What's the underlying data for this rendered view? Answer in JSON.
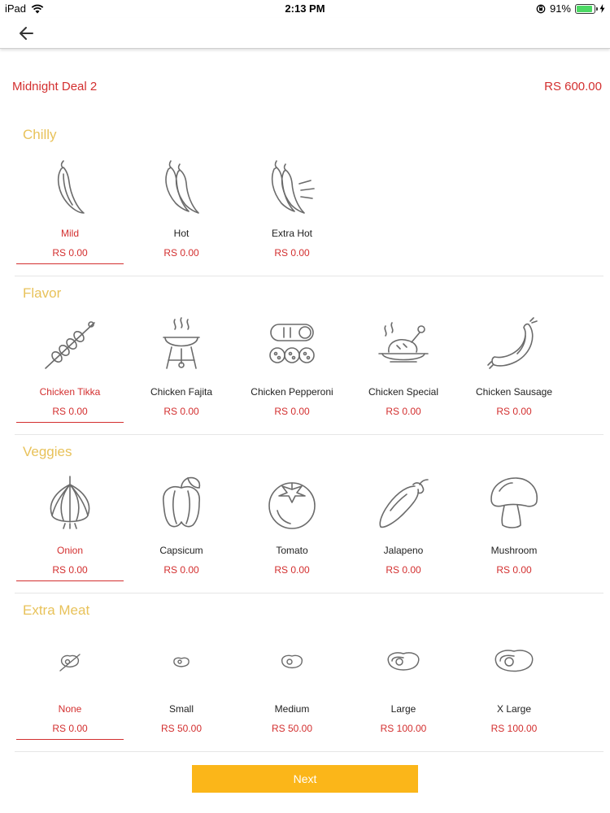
{
  "status_bar": {
    "device": "iPad",
    "time": "2:13 PM",
    "battery": "91%",
    "battery_level": 0.91
  },
  "nav": {
    "back_icon": "arrow-left-icon"
  },
  "deal": {
    "name": "Midnight Deal 2",
    "price": "RS  600.00"
  },
  "sections": {
    "chilly": {
      "title": "Chilly",
      "options": [
        {
          "label": "Mild",
          "price": "RS  0.00",
          "icon": "chili-icon",
          "selected": true
        },
        {
          "label": "Hot",
          "price": "RS  0.00",
          "icon": "two-chilies-icon",
          "selected": false
        },
        {
          "label": "Extra Hot",
          "price": "RS  0.00",
          "icon": "flaming-chilies-icon",
          "selected": false
        }
      ]
    },
    "flavor": {
      "title": "Flavor",
      "options": [
        {
          "label": "Chicken Tikka",
          "price": "RS  0.00",
          "icon": "skewer-icon",
          "selected": true
        },
        {
          "label": "Chicken Fajita",
          "price": "RS  0.00",
          "icon": "grill-icon",
          "selected": false
        },
        {
          "label": "Chicken Pepperoni",
          "price": "RS  0.00",
          "icon": "pepperoni-icon",
          "selected": false
        },
        {
          "label": "Chicken Special",
          "price": "RS  0.00",
          "icon": "roast-chicken-icon",
          "selected": false
        },
        {
          "label": "Chicken Sausage",
          "price": "RS  0.00",
          "icon": "sausage-icon",
          "selected": false
        }
      ]
    },
    "veggies": {
      "title": "Veggies",
      "options": [
        {
          "label": "Onion",
          "price": "RS  0.00",
          "icon": "onion-icon",
          "selected": true
        },
        {
          "label": "Capsicum",
          "price": "RS  0.00",
          "icon": "capsicum-icon",
          "selected": false
        },
        {
          "label": "Tomato",
          "price": "RS  0.00",
          "icon": "tomato-icon",
          "selected": false
        },
        {
          "label": "Jalapeno",
          "price": "RS  0.00",
          "icon": "jalapeno-icon",
          "selected": false
        },
        {
          "label": "Mushroom",
          "price": "RS  0.00",
          "icon": "mushroom-icon",
          "selected": false
        }
      ]
    },
    "extra_meat": {
      "title": "Extra Meat",
      "options": [
        {
          "label": "None",
          "price": "RS  0.00",
          "icon": "no-meat-icon",
          "selected": true
        },
        {
          "label": "Small",
          "price": "RS  50.00",
          "icon": "steak-small-icon",
          "selected": false
        },
        {
          "label": "Medium",
          "price": "RS  50.00",
          "icon": "steak-medium-icon",
          "selected": false
        },
        {
          "label": "Large",
          "price": "RS  100.00",
          "icon": "steak-large-icon",
          "selected": false
        },
        {
          "label": "X Large",
          "price": "RS  100.00",
          "icon": "steak-xlarge-icon",
          "selected": false
        }
      ]
    }
  },
  "next_button": {
    "label": "Next",
    "color": "#fbb619"
  },
  "colors": {
    "accent": "#d32f2f",
    "section_title": "#e8c25a",
    "icon_stroke": "#6b6b6b"
  }
}
